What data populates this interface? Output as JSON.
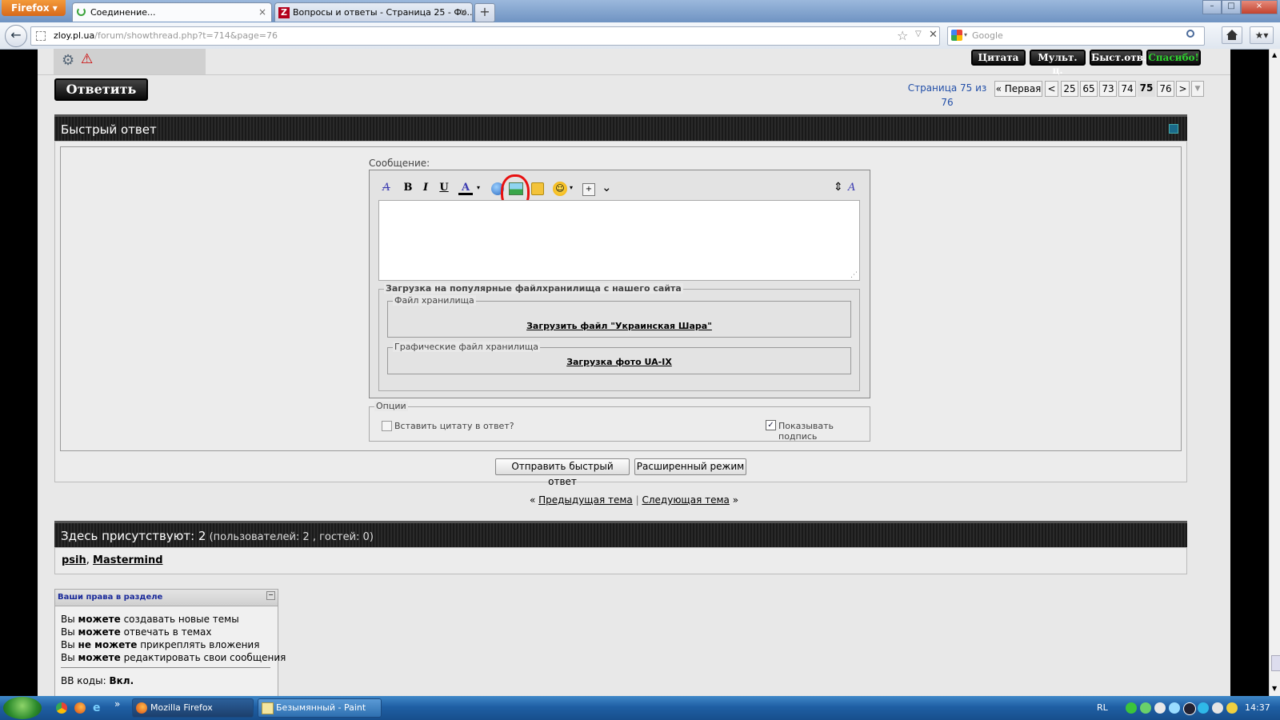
{
  "browser": {
    "menu_label": "Firefox",
    "tabs": [
      {
        "label": "Соединение...",
        "close": "×"
      },
      {
        "label": "Вопросы и ответы - Страница 25 - Фо...",
        "close": "×"
      }
    ],
    "new_tab": "+",
    "window_controls": [
      "–",
      "□",
      "×"
    ],
    "back": "←",
    "url_host": "zloy.pl.ua",
    "url_path": "/forum/showthread.php?t=714&page=76",
    "url_star": "☆",
    "url_stop": "✕",
    "search_placeholder": "Google",
    "search_icon": "search-icon",
    "home_icon": "home-icon"
  },
  "post_toolbar": {
    "buttons": [
      "Цитата",
      "Мульт. ц.",
      "Быст.отв.",
      "Спасибо!"
    ],
    "thanks_color": "#2fd22f"
  },
  "reply_button": "Ответить",
  "pagination": {
    "label": "Страница 75 из 76",
    "first": "« Первая",
    "prev": "<",
    "pages": [
      "25",
      "65",
      "73",
      "74",
      "75",
      "76"
    ],
    "current": "75",
    "next": ">",
    "menu": "▼"
  },
  "quick_reply": {
    "title": "Быстрый ответ",
    "message_label": "Сообщение:",
    "toolbar": {
      "clear_format": "A",
      "bold": "B",
      "italic": "I",
      "underline": "U",
      "font_color": "A",
      "more": "⌄",
      "resize": "⇕",
      "switch_mode": "A"
    },
    "upload_group": {
      "legend": "Загрузка на популярные файлхранилища с нашего сайта",
      "file_legend": "Файл хранилища",
      "file_link": "Загрузить файл \"Украинская Шара\"",
      "image_legend": "Графические файл хранилища",
      "image_link": "Загрузка фото UA-IX"
    },
    "options": {
      "legend": "Опции",
      "quote_label": "Вставить цитату в ответ?",
      "quote_checked": false,
      "signature_label": "Показывать подпись",
      "signature_checked": true
    },
    "submit_button": "Отправить быстрый ответ",
    "advanced_button": "Расширенный режим"
  },
  "thread_nav": {
    "left_arrows": "«",
    "prev_thread": "Предыдущая тема",
    "separator": "|",
    "next_thread": "Следующая тема",
    "right_arrows": "»"
  },
  "online": {
    "title_bold": "Здесь присутствуют: 2",
    "title_rest": " (пользователей: 2 , гостей: 0)",
    "users": [
      "psih",
      "Mastermind"
    ],
    "separator": ","
  },
  "rights": {
    "title": "Ваши права в разделе",
    "collapse": "−",
    "lines": [
      {
        "pre": "Вы ",
        "bold": "можете",
        "post": " создавать новые темы"
      },
      {
        "pre": "Вы ",
        "bold": "можете",
        "post": " отвечать в темах"
      },
      {
        "pre": "Вы ",
        "bold": "не можете",
        "post": " прикреплять вложения"
      },
      {
        "pre": "Вы ",
        "bold": "можете",
        "post": " редактировать свои сообщения"
      }
    ],
    "bbcode_label": "BB коды",
    "bbcode_value": "Вкл."
  },
  "taskbar": {
    "items": [
      "Mozilla Firefox",
      "Безымянный - Paint"
    ],
    "quicklaunch_more": "»",
    "language": "RL",
    "clock": "14:37"
  }
}
